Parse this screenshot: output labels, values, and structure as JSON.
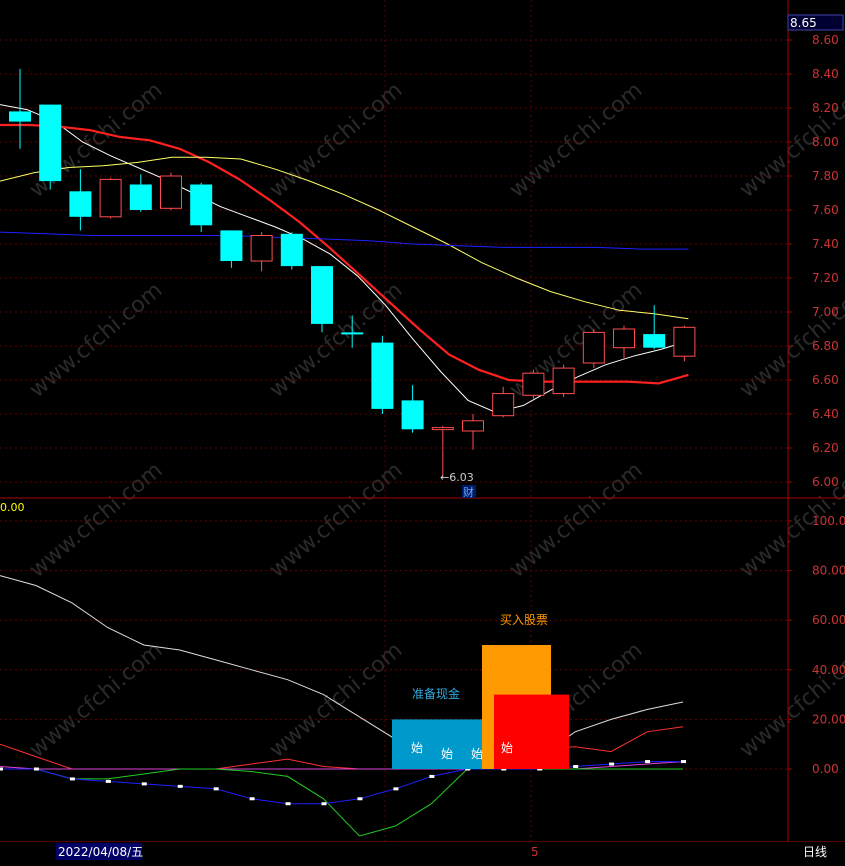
{
  "chart_data": [
    {
      "type": "candlestick",
      "panel": "price",
      "y_axis": {
        "min": 6.0,
        "max": 8.6,
        "ticks": [
          "8.60",
          "8.40",
          "8.20",
          "8.00",
          "7.80",
          "7.60",
          "7.40",
          "7.20",
          "7.00",
          "6.80",
          "6.60",
          "6.40",
          "6.20",
          "6.00"
        ]
      },
      "current_price_label": "8.65",
      "low_marker": {
        "label": "←6.03",
        "value": 6.03,
        "candle_index": 14
      },
      "event_marker": {
        "label": "财",
        "candle_index": 15
      },
      "candles": [
        {
          "open": 8.12,
          "close": 8.18,
          "high": 8.43,
          "low": 7.96,
          "color": "cyan"
        },
        {
          "open": 8.22,
          "close": 7.77,
          "high": 8.22,
          "low": 7.72,
          "color": "cyan"
        },
        {
          "open": 7.71,
          "close": 7.56,
          "high": 7.84,
          "low": 7.48,
          "color": "cyan"
        },
        {
          "open": 7.56,
          "close": 7.78,
          "high": 7.79,
          "low": 7.55,
          "color": "red"
        },
        {
          "open": 7.75,
          "close": 7.6,
          "high": 7.81,
          "low": 7.59,
          "color": "cyan"
        },
        {
          "open": 7.61,
          "close": 7.8,
          "high": 7.82,
          "low": 7.6,
          "color": "red"
        },
        {
          "open": 7.75,
          "close": 7.51,
          "high": 7.76,
          "low": 7.47,
          "color": "cyan"
        },
        {
          "open": 7.48,
          "close": 7.3,
          "high": 7.48,
          "low": 7.26,
          "color": "cyan"
        },
        {
          "open": 7.3,
          "close": 7.45,
          "high": 7.47,
          "low": 7.24,
          "color": "red"
        },
        {
          "open": 7.46,
          "close": 7.27,
          "high": 7.47,
          "low": 7.25,
          "color": "cyan"
        },
        {
          "open": 7.27,
          "close": 6.93,
          "high": 7.27,
          "low": 6.88,
          "color": "cyan"
        },
        {
          "open": 6.88,
          "close": 6.87,
          "high": 6.98,
          "low": 6.79,
          "color": "cyan"
        },
        {
          "open": 6.82,
          "close": 6.43,
          "high": 6.86,
          "low": 6.4,
          "color": "cyan"
        },
        {
          "open": 6.48,
          "close": 6.31,
          "high": 6.57,
          "low": 6.29,
          "color": "cyan"
        },
        {
          "open": 6.31,
          "close": 6.32,
          "high": 6.33,
          "low": 6.03,
          "color": "red"
        },
        {
          "open": 6.3,
          "close": 6.36,
          "high": 6.4,
          "low": 6.19,
          "color": "red"
        },
        {
          "open": 6.39,
          "close": 6.52,
          "high": 6.56,
          "low": 6.38,
          "color": "red"
        },
        {
          "open": 6.51,
          "close": 6.64,
          "high": 6.66,
          "low": 6.49,
          "color": "red"
        },
        {
          "open": 6.52,
          "close": 6.67,
          "high": 6.69,
          "low": 6.5,
          "color": "red"
        },
        {
          "open": 6.7,
          "close": 6.88,
          "high": 6.9,
          "low": 6.67,
          "color": "red"
        },
        {
          "open": 6.79,
          "close": 6.9,
          "high": 6.92,
          "low": 6.73,
          "color": "red"
        },
        {
          "open": 6.87,
          "close": 6.79,
          "high": 7.04,
          "low": 6.78,
          "color": "cyan"
        },
        {
          "open": 6.74,
          "close": 6.91,
          "high": 6.92,
          "low": 6.71,
          "color": "red"
        }
      ],
      "moving_averages": [
        {
          "color": "#ffffff",
          "values": [
            8.22,
            8.19,
            8.12,
            8.0,
            7.92,
            7.85,
            7.78,
            7.7,
            7.62,
            7.56,
            7.5,
            7.43,
            7.34,
            7.21,
            7.04,
            6.84,
            6.65,
            6.48,
            6.41,
            6.45,
            6.54,
            6.62,
            6.69,
            6.74,
            6.78,
            6.83
          ]
        },
        {
          "color": "#ff2020",
          "values": [
            8.1,
            8.1,
            8.09,
            8.07,
            8.03,
            8.01,
            7.96,
            7.88,
            7.78,
            7.66,
            7.53,
            7.38,
            7.22,
            7.06,
            6.9,
            6.75,
            6.66,
            6.6,
            6.59,
            6.59,
            6.59,
            6.59,
            6.58,
            6.63
          ]
        },
        {
          "color": "#ffff66",
          "values": [
            7.77,
            7.82,
            7.85,
            7.86,
            7.88,
            7.91,
            7.91,
            7.9,
            7.84,
            7.77,
            7.69,
            7.6,
            7.5,
            7.4,
            7.29,
            7.2,
            7.12,
            7.06,
            7.01,
            6.99,
            6.96
          ]
        },
        {
          "color": "#2020ff",
          "values": [
            7.47,
            7.46,
            7.45,
            7.45,
            7.45,
            7.45,
            7.44,
            7.43,
            7.42,
            7.4,
            7.39,
            7.38,
            7.38,
            7.38,
            7.37,
            7.37
          ]
        }
      ]
    },
    {
      "type": "indicator",
      "panel": "lower",
      "top_left_value": "0.00",
      "y_axis": {
        "min": 0,
        "max": 100,
        "ticks": [
          "100.0",
          "80.00",
          "60.00",
          "40.00",
          "20.00",
          "0.00"
        ]
      },
      "lines": [
        {
          "color": "#dddddd",
          "values": [
            78,
            74,
            67,
            57,
            50,
            48,
            44,
            40,
            36,
            30,
            21,
            12,
            3,
            0,
            0,
            5,
            15,
            20,
            24,
            27
          ]
        },
        {
          "color": "#ff3030",
          "values": [
            10,
            5,
            0,
            0,
            0,
            0,
            0,
            2,
            4,
            1,
            0,
            0,
            0,
            0,
            0,
            8,
            9,
            7,
            15,
            17
          ]
        },
        {
          "color": "#dd44dd",
          "values": [
            1,
            0,
            0,
            0,
            0,
            0,
            0,
            0,
            0,
            0,
            0,
            0,
            0,
            0,
            0,
            0,
            0,
            1,
            2,
            3
          ]
        },
        {
          "color": "#22cc22",
          "values": [
            0,
            0,
            -4,
            -4,
            -2,
            0,
            0,
            -1,
            -3,
            -12,
            -27,
            -23,
            -14,
            0,
            0,
            0,
            0,
            0,
            0,
            0
          ]
        },
        {
          "color": "#2020ff",
          "values": [
            0,
            0,
            -4,
            -5,
            -6,
            -7,
            -8,
            -12,
            -14,
            -14,
            -12,
            -8,
            -3,
            0,
            0,
            0,
            1,
            2,
            3,
            3
          ]
        }
      ],
      "signal_blocks": [
        {
          "color": "#0099cc",
          "value": 20,
          "caption": "准备现金",
          "marker": "始"
        },
        {
          "color": "#ff9900",
          "value": 50,
          "caption": "买入股票",
          "marker": "始"
        },
        {
          "color": "#ff0000",
          "value": 30,
          "caption": "",
          "marker": "始"
        }
      ],
      "extra_markers": [
        "始",
        "始"
      ]
    }
  ],
  "footer": {
    "date_label": "2022/04/08/五",
    "mid_label": "5",
    "period_label": "日线"
  },
  "watermark": "www.cfchi.com"
}
